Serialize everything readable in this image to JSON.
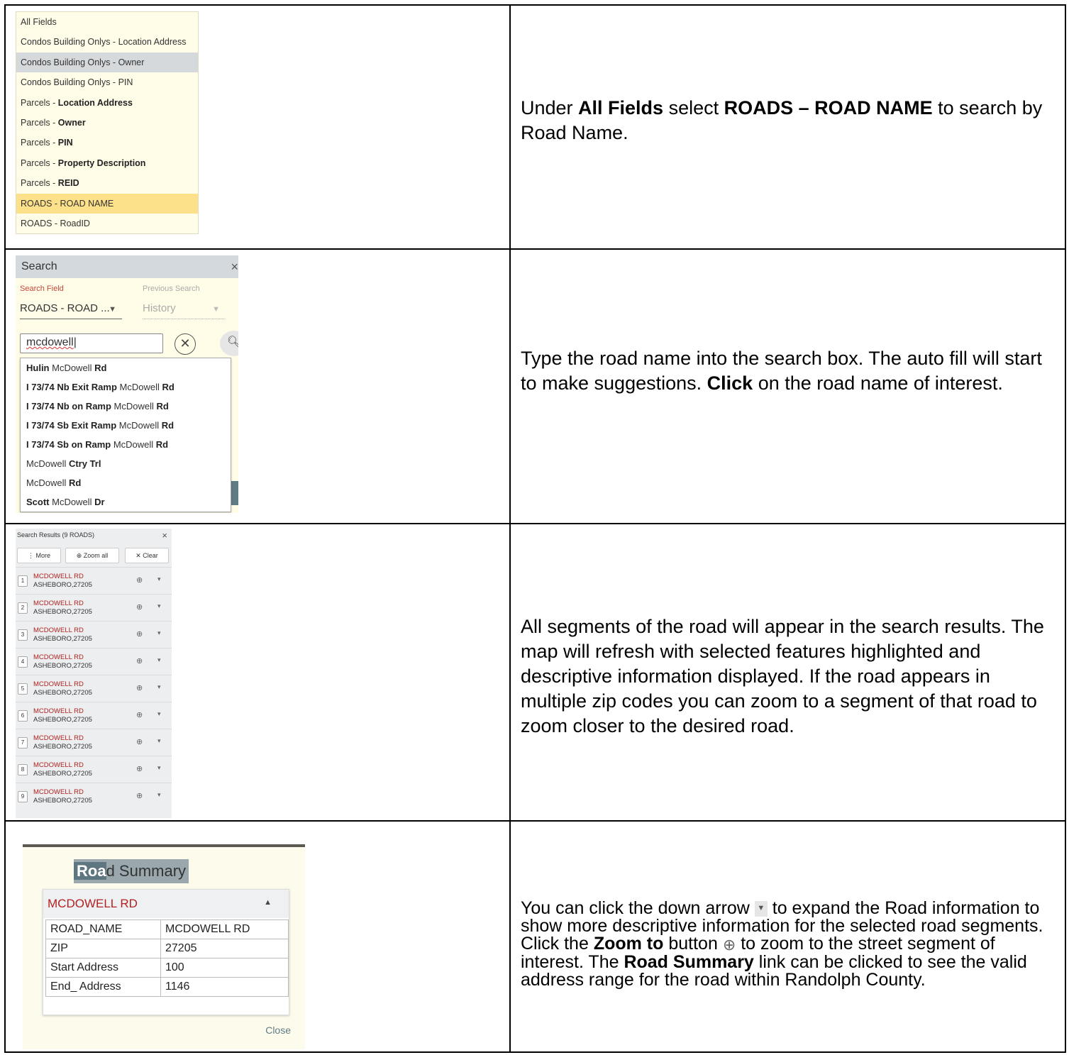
{
  "rows": [
    {
      "instruction_html_parts": [
        "Under ",
        "All Fields",
        " select ",
        "ROADS – ROAD NAME",
        " to search by Road Name."
      ]
    },
    {
      "instruction_html_parts": [
        "Type the road name into the search box. The auto fill will start to make suggestions. ",
        "Click",
        " on the road name of interest."
      ]
    },
    {
      "instruction": "All segments of the road will appear in the search results. The map will refresh with selected features highlighted and descriptive information displayed. If the road appears in multiple zip codes you can zoom to a segment of that road to zoom closer to the desired road."
    },
    {
      "instruction_html_parts": [
        "You can click the down arrow ",
        " to expand the Road information to show more descriptive information for the selected road segments. Click the ",
        "Zoom to",
        " button ",
        " to zoom to the street segment of interest. The ",
        "Road Summary",
        " link can be clicked to see the valid address range for the road within Randolph County."
      ]
    }
  ],
  "field_dropdown": {
    "items": [
      {
        "prefix": "All Fields",
        "bold": ""
      },
      {
        "prefix": "Condos Building Onlys - Location Address",
        "bold": ""
      },
      {
        "prefix": "Condos Building Onlys - Owner",
        "bold": ""
      },
      {
        "prefix": "Condos Building Onlys - PIN",
        "bold": ""
      },
      {
        "prefix": "Parcels - ",
        "bold": "Location Address"
      },
      {
        "prefix": "Parcels - ",
        "bold": "Owner"
      },
      {
        "prefix": "Parcels - ",
        "bold": "PIN"
      },
      {
        "prefix": "Parcels - ",
        "bold": "Property Description"
      },
      {
        "prefix": "Parcels - ",
        "bold": "REID"
      },
      {
        "prefix": "ROADS - ROAD NAME",
        "bold": ""
      },
      {
        "prefix": "ROADS - RoadID",
        "bold": ""
      }
    ]
  },
  "search_panel": {
    "title": "Search",
    "close_icon": "×",
    "search_field_label": "Search Field",
    "previous_search_label": "Previous Search",
    "search_field_value": "ROADS - ROAD ...",
    "history_value": "History",
    "input_value": "mcdowell",
    "suggestions": [
      {
        "parts": [
          [
            "b",
            "Hulin"
          ],
          [
            "n",
            " McDowell "
          ],
          [
            "b",
            "Rd"
          ]
        ]
      },
      {
        "parts": [
          [
            "b",
            "I 73/74 Nb Exit Ramp"
          ],
          [
            "n",
            " McDowell "
          ],
          [
            "b",
            "Rd"
          ]
        ]
      },
      {
        "parts": [
          [
            "b",
            "I 73/74 Nb on Ramp"
          ],
          [
            "n",
            " McDowell "
          ],
          [
            "b",
            "Rd"
          ]
        ]
      },
      {
        "parts": [
          [
            "b",
            "I 73/74 Sb Exit Ramp"
          ],
          [
            "n",
            " McDowell "
          ],
          [
            "b",
            "Rd"
          ]
        ]
      },
      {
        "parts": [
          [
            "b",
            "I 73/74 Sb on Ramp"
          ],
          [
            "n",
            " McDowell "
          ],
          [
            "b",
            "Rd"
          ]
        ]
      },
      {
        "parts": [
          [
            "n",
            "McDowell "
          ],
          [
            "b",
            "Ctry Trl"
          ]
        ]
      },
      {
        "parts": [
          [
            "n",
            "McDowell "
          ],
          [
            "b",
            "Rd"
          ]
        ]
      },
      {
        "parts": [
          [
            "b",
            "Scott"
          ],
          [
            "n",
            " McDowell "
          ],
          [
            "b",
            "Dr"
          ]
        ]
      }
    ]
  },
  "results_panel": {
    "title": "Search Results (9 ROADS)",
    "close_icon": "×",
    "more_label": "⋮ More",
    "zoom_all_label": "⊕ Zoom all",
    "clear_label": "✕ Clear",
    "results": [
      {
        "num": "1",
        "name": "MCDOWELL RD",
        "zip": "ASHEBORO,27205"
      },
      {
        "num": "2",
        "name": "MCDOWELL RD",
        "zip": "ASHEBORO,27205"
      },
      {
        "num": "3",
        "name": "MCDOWELL RD",
        "zip": "ASHEBORO,27205"
      },
      {
        "num": "4",
        "name": "MCDOWELL RD",
        "zip": "ASHEBORO,27205"
      },
      {
        "num": "5",
        "name": "MCDOWELL RD",
        "zip": "ASHEBORO,27205"
      },
      {
        "num": "6",
        "name": "MCDOWELL RD",
        "zip": "ASHEBORO,27205"
      },
      {
        "num": "7",
        "name": "MCDOWELL RD",
        "zip": "ASHEBORO,27205"
      },
      {
        "num": "8",
        "name": "MCDOWELL RD",
        "zip": "ASHEBORO,27205"
      },
      {
        "num": "9",
        "name": "MCDOWELL RD",
        "zip": "ASHEBORO,27205"
      }
    ]
  },
  "road_summary": {
    "title_highlight": "Roa",
    "title_rest": "d Summary",
    "card_title": "MCDOWELL RD",
    "fields": [
      {
        "key": "ROAD_NAME",
        "value": "MCDOWELL RD"
      },
      {
        "key": "ZIP",
        "value": "27205"
      },
      {
        "key": "Start Address",
        "value": "100"
      },
      {
        "key": "End_ Address",
        "value": "1146"
      }
    ],
    "close_label": "Close"
  }
}
